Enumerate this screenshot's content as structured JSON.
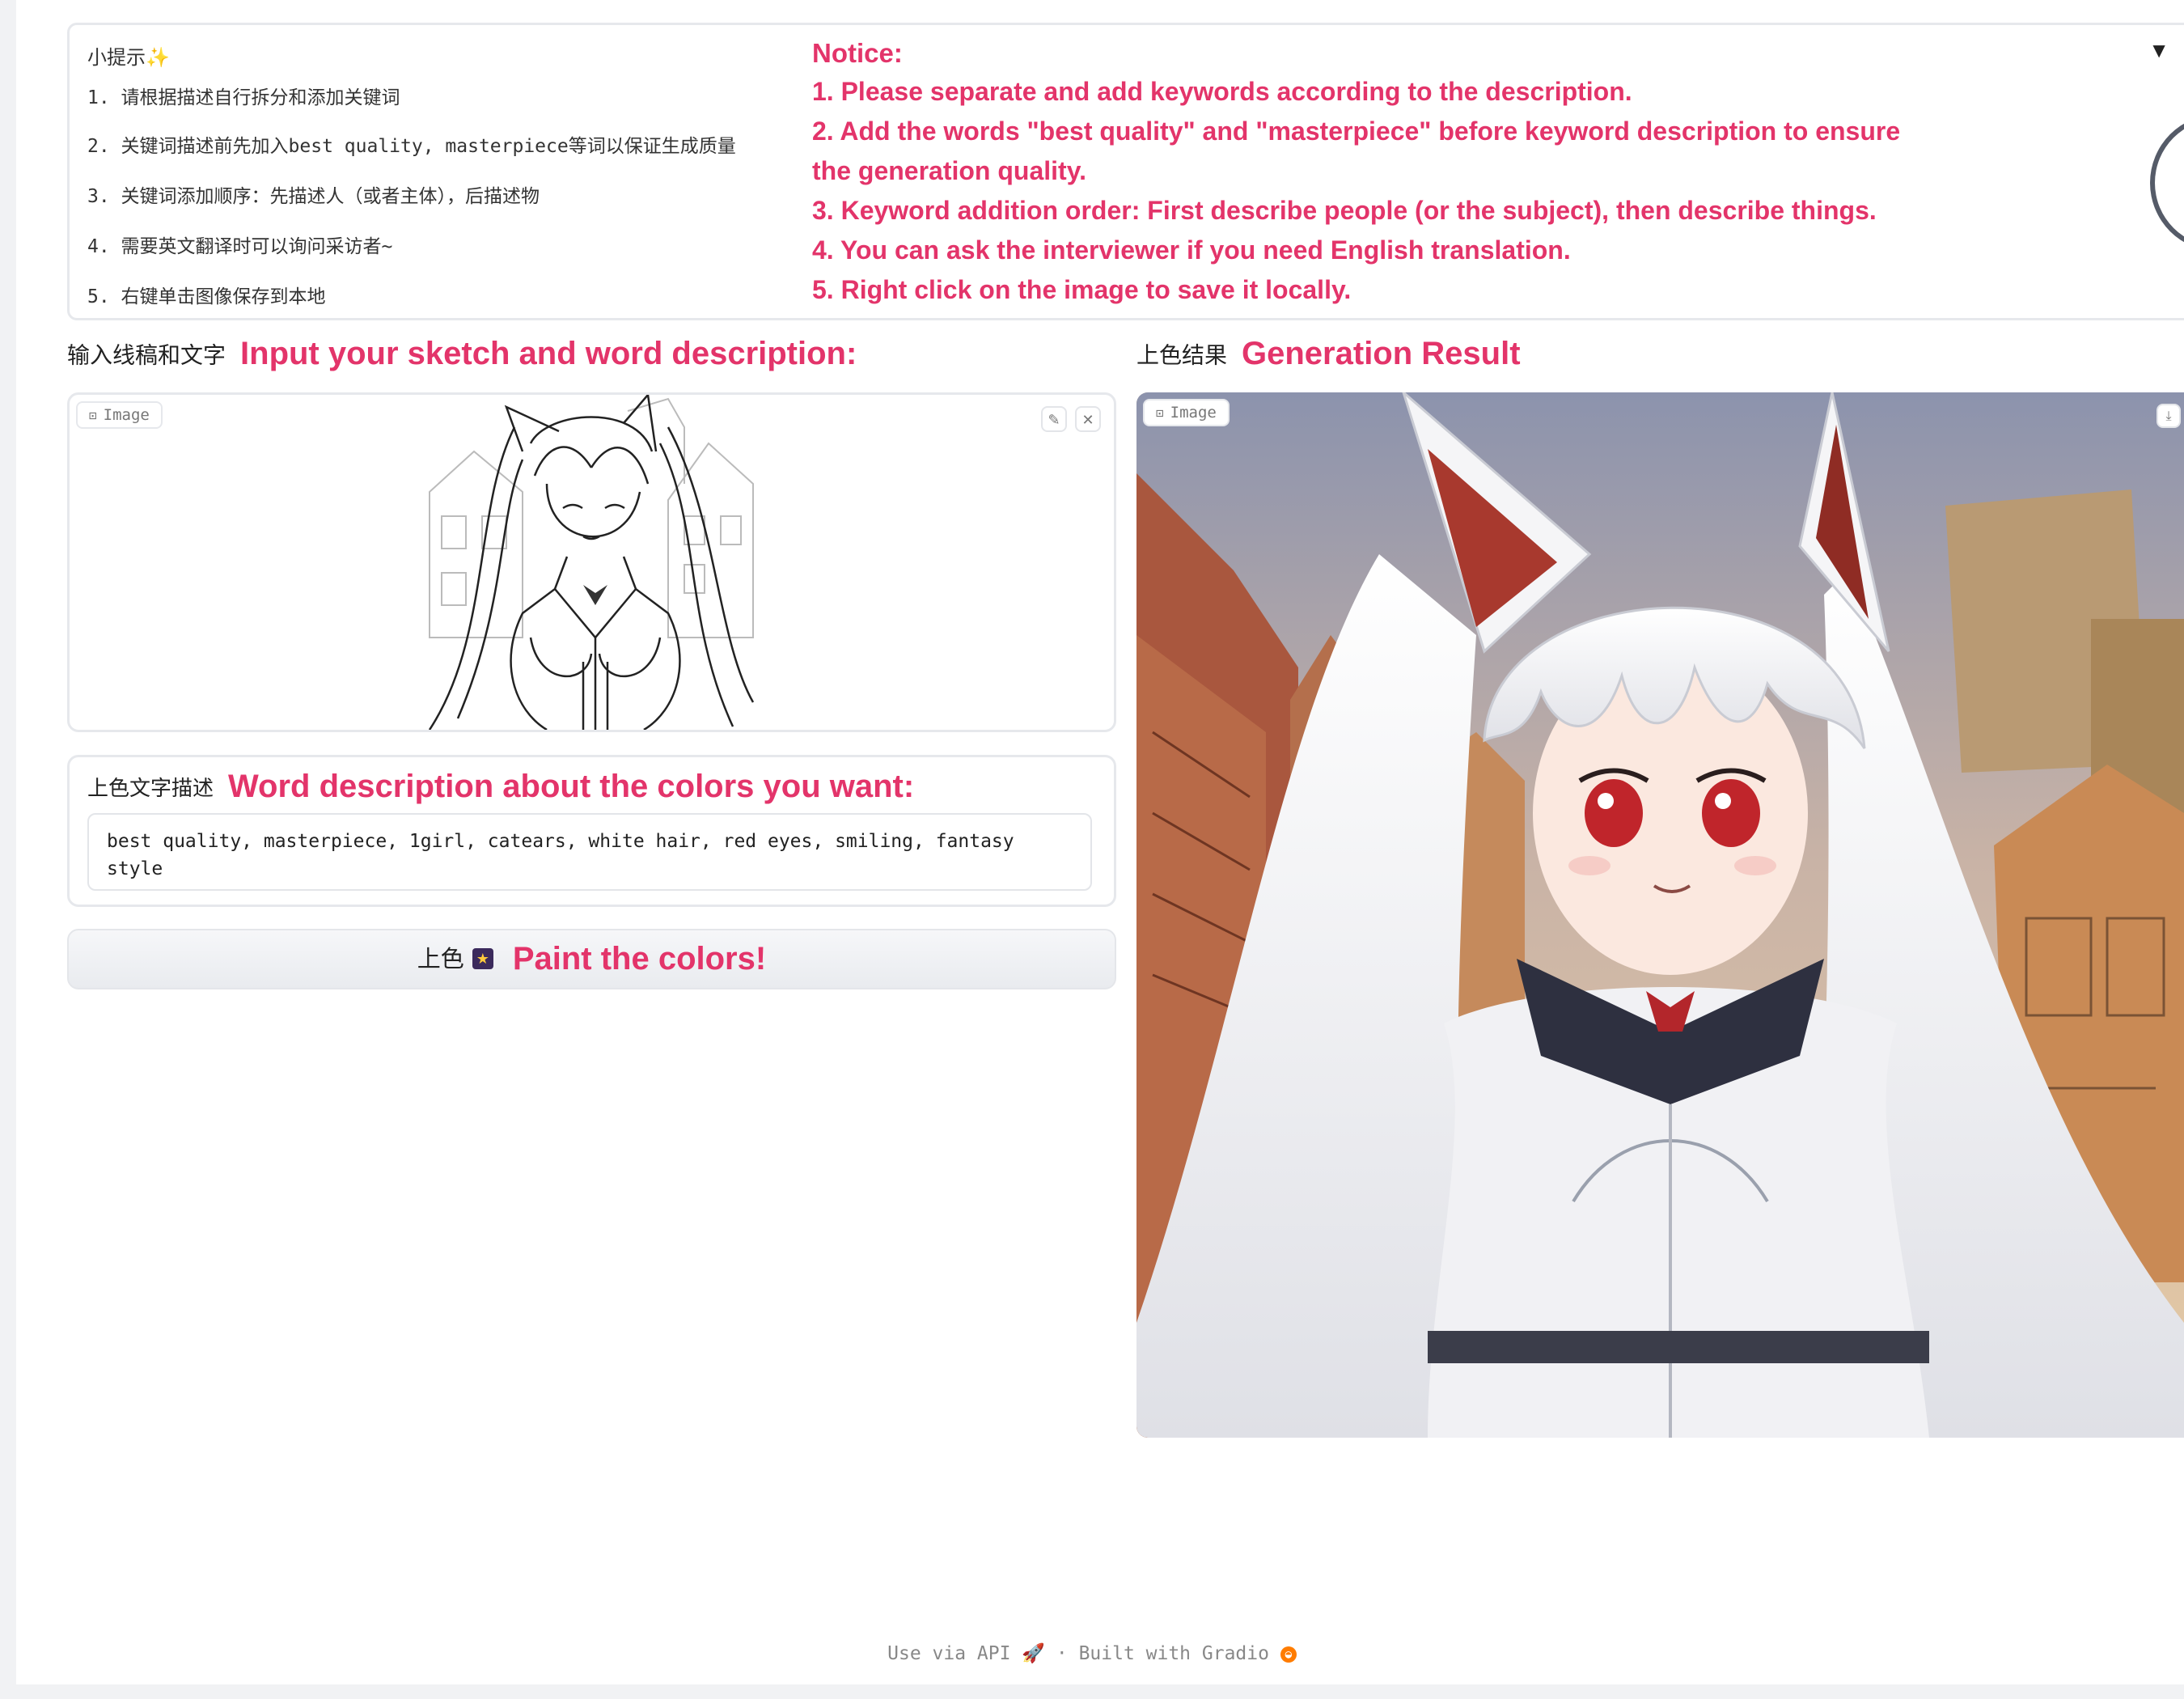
{
  "tips": {
    "title": "小提示✨",
    "items": [
      "1. 请根据描述自行拆分和添加关键词",
      "2. 关键词描述前先加入best quality, masterpiece等词以保证生成质量",
      "3. 关键词添加顺序：先描述人（或者主体），后描述物",
      "4. 需要英文翻译时可以询问采访者~",
      "5. 右键单击图像保存到本地"
    ]
  },
  "notice": {
    "title": "Notice:",
    "lines": [
      "1. Please separate and add keywords according to the description.",
      "2. Add the words \"best quality\" and \"masterpiece\" before keyword description to ensure",
      "the generation quality.",
      "3. Keyword addition order: First describe people (or the subject), then describe things.",
      "4. You can ask the interviewer if you need English translation.",
      "5. Right click on the image to save it locally."
    ],
    "collapse_icon": "▼"
  },
  "input_section": {
    "label_cn": "输入线稿和文字",
    "label_en": "Input your sketch and word description:",
    "image_badge": "Image",
    "edit_icon": "✎",
    "clear_icon": "✕"
  },
  "description": {
    "label_cn": "上色文字描述",
    "label_en": "Word description about the colors you want:",
    "prompt": "best quality, masterpiece, 1girl, catears, white hair, red eyes, smiling, fantasy style"
  },
  "paint_button": {
    "label_cn": "上色",
    "icon": "★",
    "label_en": "Paint the colors!"
  },
  "output_section": {
    "label_cn": "上色结果",
    "label_en": "Generation Result",
    "image_badge": "Image",
    "download_icon": "⤓"
  },
  "footer": {
    "api_text": "Use via API",
    "separator": "·",
    "built_text": "Built with Gradio"
  },
  "colors": {
    "accent": "#e3346a",
    "border": "#e6e8ec",
    "text": "#222222"
  }
}
